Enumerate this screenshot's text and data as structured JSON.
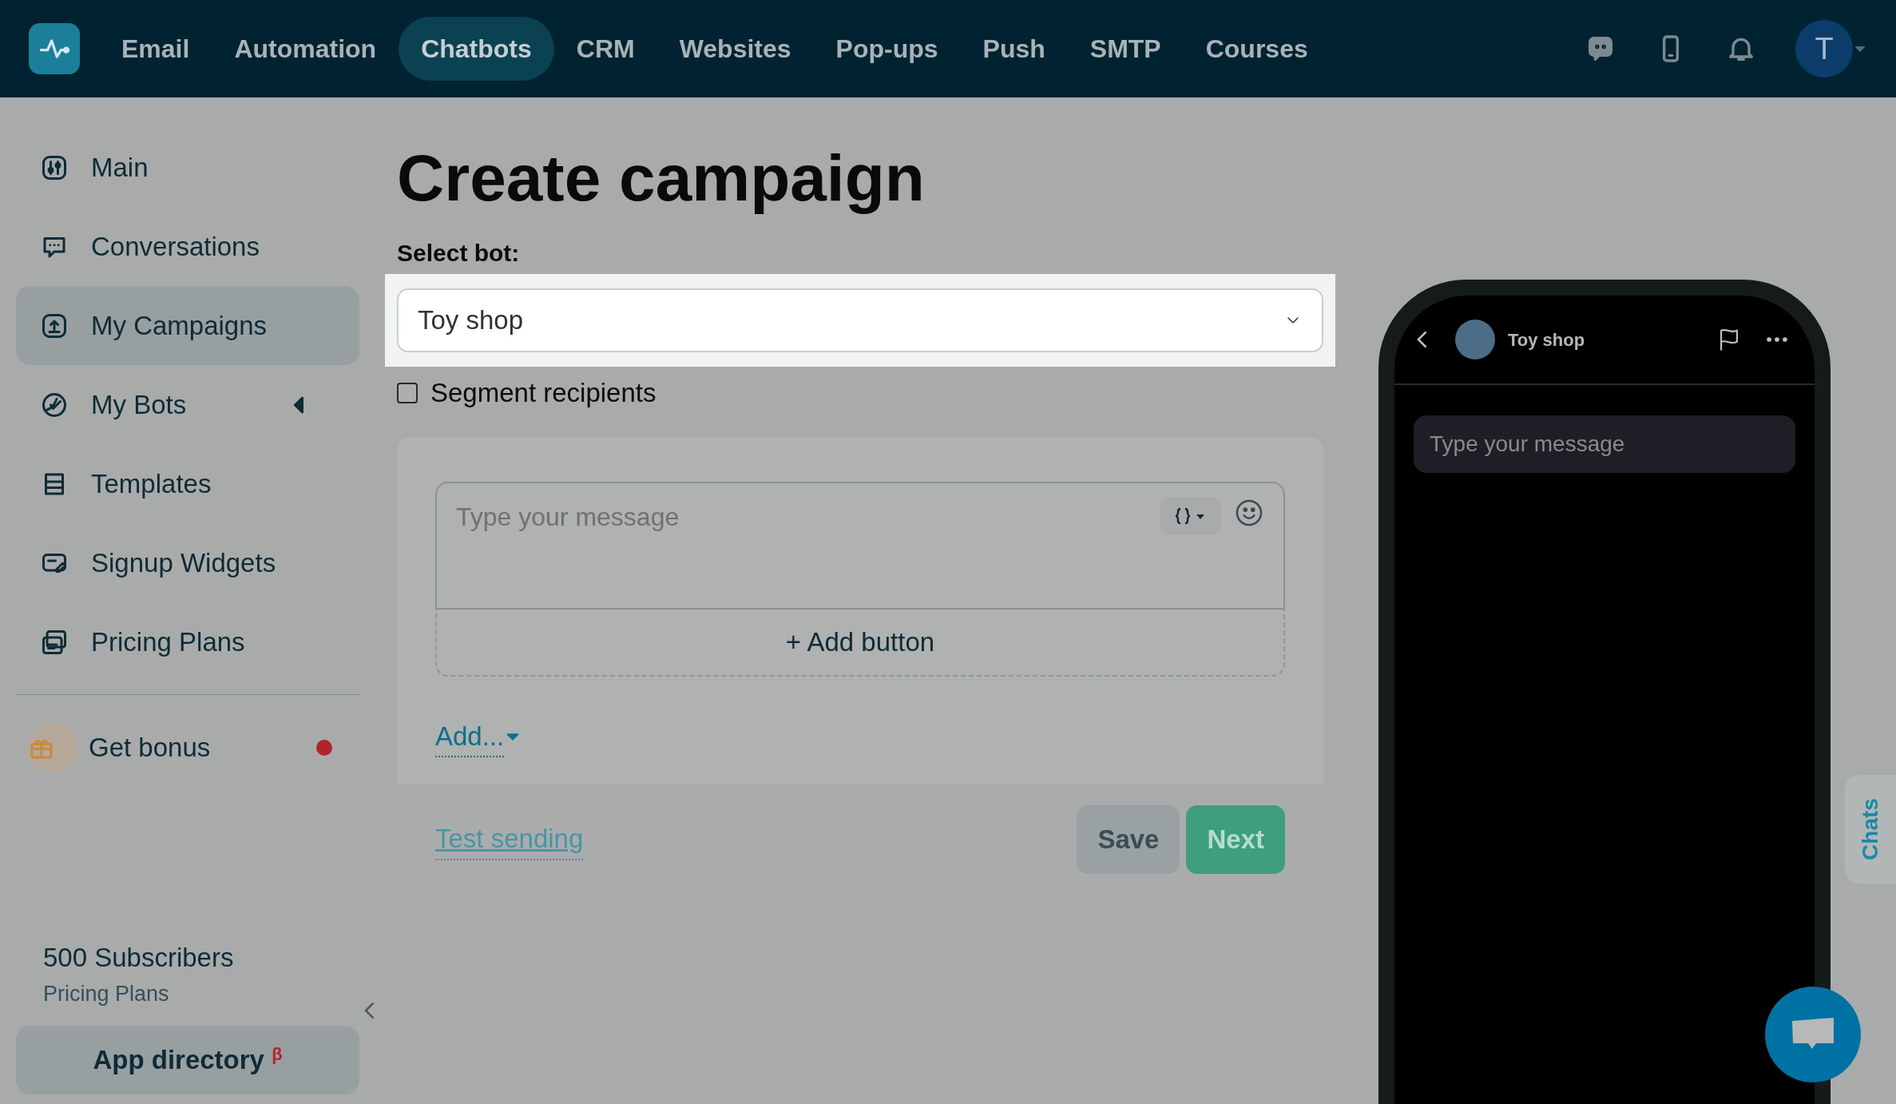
{
  "nav": {
    "items": [
      {
        "label": "Email",
        "selected": false
      },
      {
        "label": "Automation",
        "selected": false
      },
      {
        "label": "Chatbots",
        "selected": true
      },
      {
        "label": "CRM",
        "selected": false
      },
      {
        "label": "Websites",
        "selected": false
      },
      {
        "label": "Pop-ups",
        "selected": false
      },
      {
        "label": "Push",
        "selected": false
      },
      {
        "label": "SMTP",
        "selected": false
      },
      {
        "label": "Courses",
        "selected": false
      }
    ],
    "avatar": "T"
  },
  "sidebar": {
    "items": [
      {
        "label": "Main",
        "kind": "link",
        "selected": false
      },
      {
        "label": "Conversations",
        "kind": "link",
        "selected": false
      },
      {
        "label": "My Campaigns",
        "kind": "link",
        "selected": true
      },
      {
        "label": "My Bots",
        "kind": "group",
        "selected": false,
        "expanded": false
      },
      {
        "label": "Templates",
        "kind": "link",
        "selected": false
      },
      {
        "label": "Signup Widgets",
        "kind": "link",
        "selected": false
      },
      {
        "label": "Pricing Plans",
        "kind": "link",
        "selected": false
      }
    ],
    "bonus": {
      "label": "Get bonus",
      "notification": true
    },
    "plan": {
      "subscribers": "500 Subscribers",
      "link": "Pricing Plans"
    },
    "app_directory": {
      "label": "App directory",
      "badge": "β"
    }
  },
  "page": {
    "title": "Create campaign",
    "select_label": "Select bot:",
    "bot": "Toy shop",
    "segment": {
      "label": "Segment recipients",
      "checked": false
    },
    "message_placeholder": "Type your message",
    "add_button": "+ Add button",
    "add_menu": "Add...",
    "test_sending": "Test sending",
    "save": "Save",
    "next": "Next"
  },
  "preview": {
    "bot_name": "Toy shop",
    "placeholder": "Type your message"
  },
  "chats_tab": "Chats"
}
